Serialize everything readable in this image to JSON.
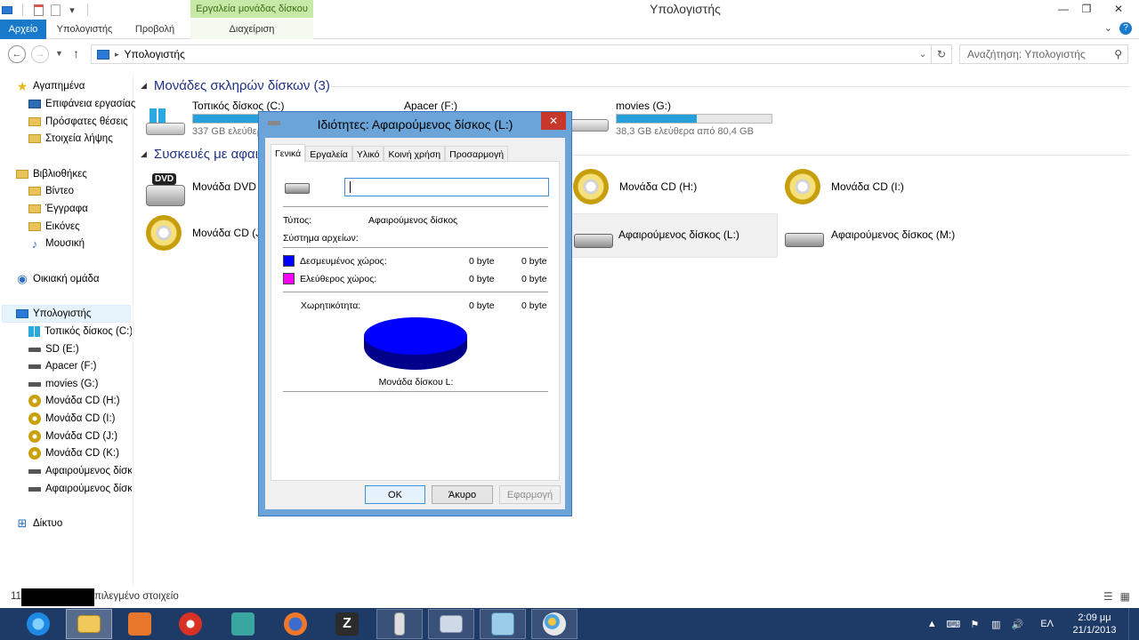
{
  "window": {
    "title": "Υπολογιστής",
    "context_tab_header": "Εργαλεία μονάδας δίσκου"
  },
  "ribbon": {
    "tabs": [
      {
        "label": "Αρχείο"
      },
      {
        "label": "Υπολογιστής"
      },
      {
        "label": "Προβολή"
      },
      {
        "label": "Διαχείριση"
      }
    ]
  },
  "address": {
    "path": "Υπολογιστής",
    "search_placeholder": "Αναζήτηση: Υπολογιστής"
  },
  "nav": {
    "favorites": "Αγαπημένα",
    "desktop": "Επιφάνεια εργασίας",
    "recent": "Πρόσφατες θέσεις",
    "downloads": "Στοιχεία λήψης",
    "libraries": "Βιβλιοθήκες",
    "videos": "Βίντεο",
    "documents": "Έγγραφα",
    "pictures": "Εικόνες",
    "music": "Μουσική",
    "homegroup": "Οικιακή ομάδα",
    "computer": "Υπολογιστής",
    "drive_c": "Τοπικός δίσκος (C:)",
    "drive_e": "SD (E:)",
    "drive_f": "Apacer (F:)",
    "drive_g": "movies (G:)",
    "drive_h": "Μονάδα CD (H:)",
    "drive_i": "Μονάδα CD (I:)",
    "drive_j": "Μονάδα CD (J:)",
    "drive_k": "Μονάδα CD (K:)",
    "removable_1": "Αφαιρούμενος δίσκ",
    "removable_2": "Αφαιρούμενος δίσκ",
    "network": "Δίκτυο"
  },
  "content": {
    "group_hdd": "Μονάδες σκληρών δίσκων (3)",
    "group_removable": "Συσκευές με αφαιρ",
    "drive_c": {
      "name": "Τοπικός δίσκος (C:)",
      "info": "337 GB ελεύθερ",
      "used_fraction": 0.42
    },
    "drive_f": {
      "name": "Apacer (F:)"
    },
    "drive_g": {
      "name": "movies (G:)",
      "info": "38,3 GB ελεύθερα από 80,4 GB",
      "used_fraction": 0.52
    },
    "dvd": "Μονάδα DVD R",
    "cd_j": "Μονάδα CD (J:",
    "cd_h": "Μονάδα CD (H:)",
    "cd_i": "Μονάδα CD (I:)",
    "removable_l": "Αφαιρούμενος δίσκος (L:)",
    "removable_m": "Αφαιρούμενος δίσκος (M:)"
  },
  "status": {
    "count_prefix": "11",
    "selected_text": "πιλεγμένο στοιχείο"
  },
  "dialog": {
    "title": "Ιδιότητες: Αφαιρούμενος δίσκος (L:)",
    "tabs": [
      "Γενικά",
      "Εργαλεία",
      "Υλικό",
      "Κοινή χρήση",
      "Προσαρμογή"
    ],
    "name_value": "",
    "type_label": "Τύπος:",
    "type_value": "Αφαιρούμενος δίσκος",
    "fs_label": "Σύστημα αρχείων:",
    "used_label": "Δεσμευμένος χώρος:",
    "used_bytes": "0 byte",
    "used_size": "0 byte",
    "free_label": "Ελεύθερος χώρος:",
    "free_bytes": "0 byte",
    "free_size": "0 byte",
    "capacity_label": "Χωρητικότητα:",
    "capacity_bytes": "0 byte",
    "capacity_size": "0 byte",
    "drive_caption": "Μονάδα δίσκου L:",
    "used_color": "#0000ff",
    "free_color": "#ff00ff",
    "ok": "OK",
    "cancel": "Άκυρο",
    "apply": "Εφαρμογή"
  },
  "taskbar": {
    "language": "ΕΛ",
    "time": "2:09 μμ",
    "date": "21/1/2013"
  }
}
